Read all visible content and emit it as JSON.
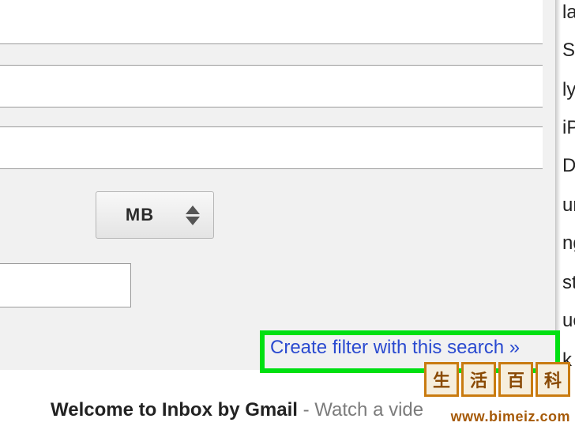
{
  "panel": {
    "field1_value": "",
    "field2_value": "",
    "field3_value": "",
    "size_unit": "MB",
    "small_input_value": "",
    "create_filter_label": "Create filter with this search »"
  },
  "inbox": {
    "welcome_bold": "Welcome to Inbox by Gmail",
    "welcome_rest": " - Watch a vide"
  },
  "side": {
    "i0": "la",
    "i1": "Ste",
    "i2": "ly",
    "i3": "iP",
    "i4": "De",
    "i5": "urit",
    "i6": "ng",
    "i7": "sta",
    "i8": "ues",
    "i9": "k"
  },
  "watermark": {
    "c1": "生",
    "c2": "活",
    "c3": "百",
    "c4": "科",
    "url": "www.bimeiz.com"
  }
}
